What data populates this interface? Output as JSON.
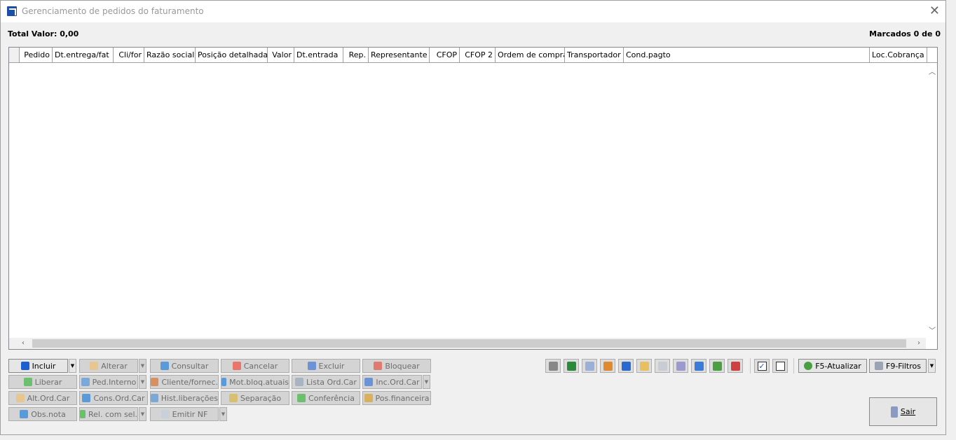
{
  "window": {
    "title": "Gerenciamento de pedidos do faturamento"
  },
  "summary": {
    "total_valor": "Total Valor: 0,00",
    "marcados": "Marcados 0 de 0"
  },
  "grid": {
    "columns": [
      "",
      "Pedido",
      "Dt.entrega/fat",
      "Cli/for",
      "Razão social",
      "Posição detalhada",
      "Valor",
      "Dt.entrada",
      "Rep.",
      "Representante",
      "CFOP",
      "CFOP 2",
      "Ordem de compra",
      "Transportador",
      "Cond.pagto",
      "Loc.Cobrança"
    ],
    "rows": []
  },
  "actions": [
    {
      "label": "Incluir",
      "icon": "plus-icon",
      "color": "#1c5fd1",
      "enabled": true,
      "dropdown": true
    },
    {
      "label": "Alterar",
      "icon": "edit-icon",
      "color": "#e8c690",
      "enabled": false,
      "dropdown": true
    },
    {
      "label": "Consultar",
      "icon": "search-doc-icon",
      "color": "#5a9ad8",
      "enabled": false
    },
    {
      "label": "Cancelar",
      "icon": "cancel-icon",
      "color": "#e8766a",
      "enabled": false
    },
    {
      "label": "Excluir",
      "icon": "minus-icon",
      "color": "#6b93d6",
      "enabled": false
    },
    {
      "label": "Bloquear",
      "icon": "block-icon",
      "color": "#e07a70",
      "enabled": false
    },
    {
      "label": "Liberar",
      "icon": "release-icon",
      "color": "#6cbf6c",
      "enabled": false
    },
    {
      "label": "Ped.Interno",
      "icon": "internal-order-icon",
      "color": "#7aa8d8",
      "enabled": false,
      "dropdown": true
    },
    {
      "label": "Cliente/fornec.",
      "icon": "person-icon",
      "color": "#d89060",
      "enabled": false
    },
    {
      "label": "Mot.bloq.atuais",
      "icon": "search-doc-icon",
      "color": "#5a9ad8",
      "enabled": false
    },
    {
      "label": "Lista Ord.Car",
      "icon": "printer-icon",
      "color": "#a8b4c4",
      "enabled": false
    },
    {
      "label": "Inc.Ord.Car",
      "icon": "plus-icon",
      "color": "#6b93d6",
      "enabled": false,
      "dropdown": true
    },
    {
      "label": "Alt.Ord.Car",
      "icon": "edit-icon",
      "color": "#e8c690",
      "enabled": false
    },
    {
      "label": "Cons.Ord.Car",
      "icon": "search-doc-icon",
      "color": "#5a9ad8",
      "enabled": false
    },
    {
      "label": "Hist.liberações",
      "icon": "history-icon",
      "color": "#7aa8d8",
      "enabled": false
    },
    {
      "label": "Separação",
      "icon": "separation-icon",
      "color": "#d8c070",
      "enabled": false
    },
    {
      "label": "Conferência",
      "icon": "check-doc-icon",
      "color": "#6cbf6c",
      "enabled": false
    },
    {
      "label": "Pos.financeira",
      "icon": "money-bag-icon",
      "color": "#d8b060",
      "enabled": false
    },
    {
      "label": "Obs.nota",
      "icon": "search-doc-icon",
      "color": "#5a9ad8",
      "enabled": false
    },
    {
      "label": "Rel. com sel.",
      "icon": "chart-icon",
      "color": "#6cbf6c",
      "enabled": false,
      "dropdown": true
    },
    {
      "label": "Emitir NF",
      "icon": "document-icon",
      "color": "#c8d0dc",
      "enabled": false,
      "dropdown": true
    }
  ],
  "toolbar": {
    "icons": [
      {
        "name": "binoculars-icon",
        "color": "#888"
      },
      {
        "name": "excel-icon",
        "color": "#2a8a3a"
      },
      {
        "name": "document-icon",
        "color": "#9ab0d8"
      },
      {
        "name": "table-export-icon",
        "color": "#e08a30"
      },
      {
        "name": "sort-icon",
        "color": "#2a6ad0"
      },
      {
        "name": "palette-icon",
        "color": "#e8c060"
      },
      {
        "name": "eraser-icon",
        "color": "#c8ccd4"
      },
      {
        "name": "gear-icon",
        "color": "#9a9ad0"
      },
      {
        "name": "list-icon",
        "color": "#3a7ad8"
      },
      {
        "name": "download-icon",
        "color": "#4aa040"
      },
      {
        "name": "checklist-icon",
        "color": "#d04040"
      }
    ],
    "check_all": {
      "checked": true
    },
    "uncheck_all": {
      "checked": false
    },
    "refresh_label": "F5-Atualizar",
    "filters_label": "F9-Filtros",
    "exit_label": "Sair"
  }
}
